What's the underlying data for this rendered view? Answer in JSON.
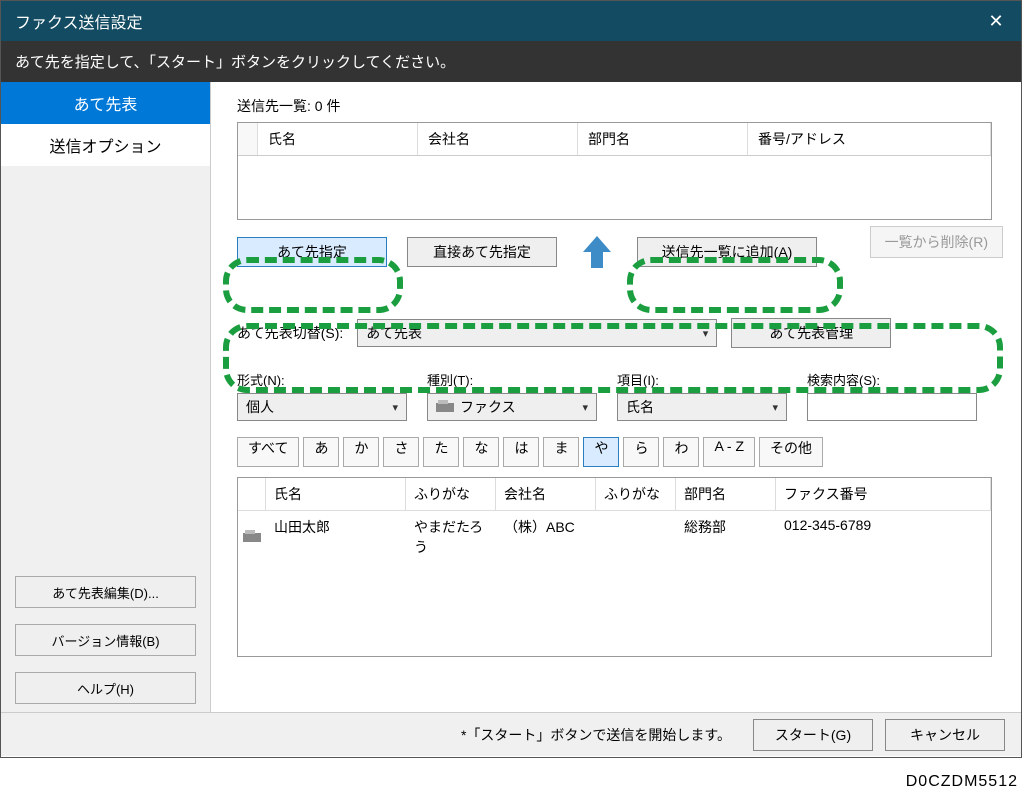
{
  "titlebar": {
    "title": "ファクス送信設定"
  },
  "subtitle": "あて先を指定して、「スタート」ボタンをクリックしてください。",
  "sidebar": {
    "tab_destinations": "あて先表",
    "tab_options": "送信オプション",
    "btn_edit": "あて先表編集(D)...",
    "btn_version": "バージョン情報(B)",
    "btn_help": "ヘルプ(H)"
  },
  "main": {
    "list_label": "送信先一覧: 0 件",
    "cols": {
      "name": "氏名",
      "company": "会社名",
      "dept": "部門名",
      "number": "番号/アドレス"
    },
    "btn_specify": "あて先指定",
    "btn_direct": "直接あて先指定",
    "btn_addlist": "送信先一覧に追加(A)",
    "btn_remove": "一覧から削除(R)",
    "switch_label": "あて先表切替(S):",
    "switch_value": "あて先表",
    "btn_manage": "あて先表管理",
    "filters": {
      "format_label": "形式(N):",
      "format_value": "個人",
      "type_label": "種別(T):",
      "type_value": "ファクス",
      "field_label": "項目(I):",
      "field_value": "氏名",
      "search_label": "検索内容(S):"
    },
    "kana": [
      "すべて",
      "あ",
      "か",
      "さ",
      "た",
      "な",
      "は",
      "ま",
      "や",
      "ら",
      "わ",
      "A - Z",
      "その他"
    ],
    "kana_active": "や",
    "result_cols": {
      "name": "氏名",
      "furigana1": "ふりがな",
      "company": "会社名",
      "furigana2": "ふりがな",
      "dept": "部門名",
      "fax": "ファクス番号"
    },
    "result_row": {
      "name": "山田太郎",
      "furigana1": "やまだたろう",
      "company": "（株）ABC",
      "furigana2": "",
      "dept": "総務部",
      "fax": "012-345-6789"
    }
  },
  "footer": {
    "note": "*「スタート」ボタンで送信を開始します。",
    "btn_start": "スタート(G)",
    "btn_cancel": "キャンセル"
  },
  "image_id": "D0CZDM5512"
}
